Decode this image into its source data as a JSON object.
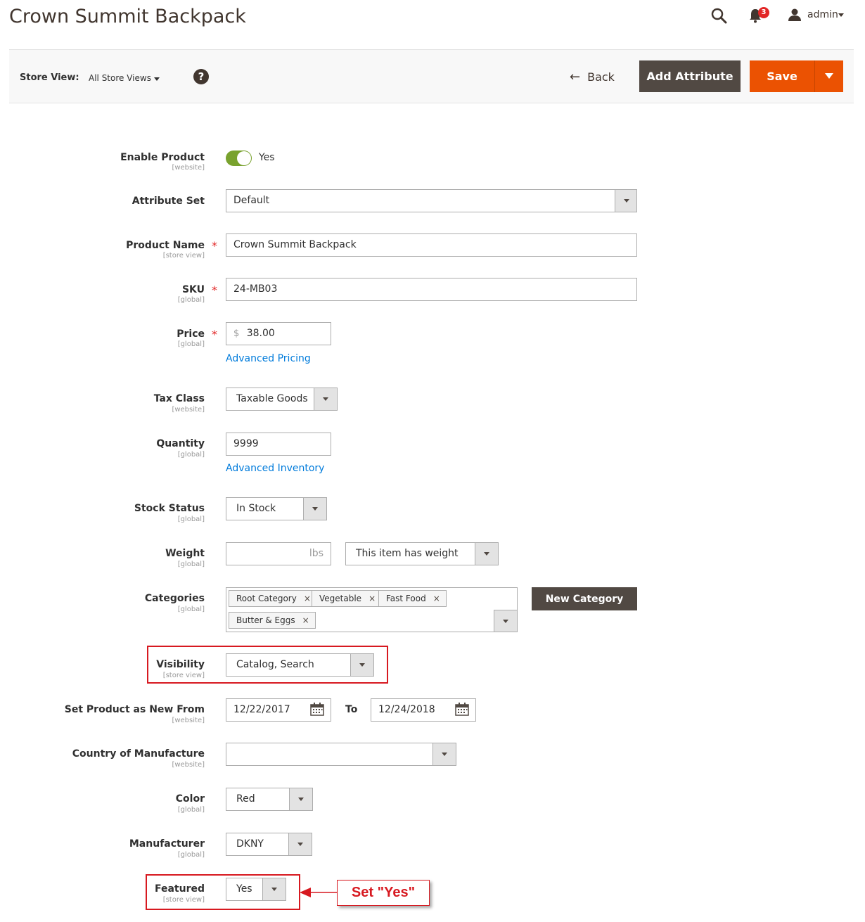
{
  "page": {
    "title": "Crown Summit Backpack"
  },
  "header": {
    "notifications_count": "3",
    "user": "admin"
  },
  "toolbar": {
    "store_view_label": "Store View:",
    "store_view_value": "All Store Views",
    "help": "?",
    "back_label": "Back",
    "add_attribute_label": "Add Attribute",
    "save_label": "Save"
  },
  "fields": {
    "enable_product": {
      "label": "Enable Product",
      "scope": "[website]",
      "value": "Yes",
      "enabled": true
    },
    "attribute_set": {
      "label": "Attribute Set",
      "value": "Default"
    },
    "product_name": {
      "label": "Product Name",
      "scope": "[store view]",
      "value": "Crown Summit Backpack",
      "required": "*"
    },
    "sku": {
      "label": "SKU",
      "scope": "[global]",
      "value": "24-MB03",
      "required": "*"
    },
    "price": {
      "label": "Price",
      "scope": "[global]",
      "currency": "$",
      "value": "38.00",
      "required": "*",
      "link": "Advanced Pricing"
    },
    "tax_class": {
      "label": "Tax Class",
      "scope": "[website]",
      "value": "Taxable Goods"
    },
    "quantity": {
      "label": "Quantity",
      "scope": "[global]",
      "value": "9999",
      "link": "Advanced Inventory"
    },
    "stock_status": {
      "label": "Stock Status",
      "scope": "[global]",
      "value": "In Stock"
    },
    "weight": {
      "label": "Weight",
      "scope": "[global]",
      "value": "",
      "unit": "lbs",
      "type_value": "This item has weight"
    },
    "categories": {
      "label": "Categories",
      "scope": "[global]",
      "tags": [
        "Root Category",
        "Vegetable",
        "Fast Food",
        "Butter & Eggs"
      ],
      "new_button": "New Category"
    },
    "visibility": {
      "label": "Visibility",
      "scope": "[store view]",
      "value": "Catalog, Search"
    },
    "new_from": {
      "label": "Set Product as New From",
      "scope": "[website]",
      "from": "12/22/2017",
      "to_label": "To",
      "to": "12/24/2018"
    },
    "country": {
      "label": "Country of Manufacture",
      "scope": "[website]",
      "value": ""
    },
    "color": {
      "label": "Color",
      "scope": "[global]",
      "value": "Red"
    },
    "manufacturer": {
      "label": "Manufacturer",
      "scope": "[global]",
      "value": "DKNY"
    },
    "featured": {
      "label": "Featured",
      "scope": "[store view]",
      "value": "Yes"
    }
  },
  "annotation": {
    "text": "Set \"Yes\"",
    "color": "#d71920"
  },
  "colors": {
    "primary": "#eb5202",
    "dark": "#514943",
    "link": "#007bdb",
    "toggle_on": "#79a22e",
    "required": "#e22626"
  }
}
